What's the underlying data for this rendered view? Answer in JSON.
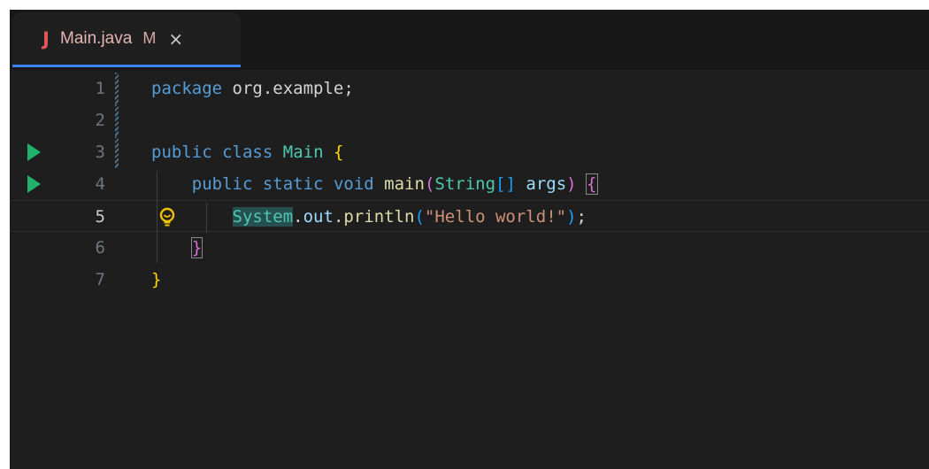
{
  "tab": {
    "icon": "java-icon",
    "name": "Main.java",
    "status": "M",
    "close": "×"
  },
  "lines": [
    {
      "number": "1"
    },
    {
      "number": "2"
    },
    {
      "number": "3"
    },
    {
      "number": "4"
    },
    {
      "number": "5"
    },
    {
      "number": "6"
    },
    {
      "number": "7"
    }
  ],
  "code": {
    "l1": {
      "kw": "package",
      "rest": " org.example;"
    },
    "l3": {
      "kw1": "public",
      "kw2": "class",
      "name": "Main",
      "brace": "{"
    },
    "l4": {
      "kw1": "public",
      "kw2": "static",
      "kw3": "void",
      "fn": "main",
      "lparen": "(",
      "type": "String",
      "arr": "[]",
      "param": "args",
      "rparen": ")",
      "brace": "{"
    },
    "l5": {
      "cls": "System",
      "dot1": ".",
      "field": "out",
      "dot2": ".",
      "fn": "println",
      "lparen": "(",
      "str": "\"Hello world!\"",
      "rparen": ")",
      "semi": ";"
    },
    "l6": {
      "brace": "}"
    },
    "l7": {
      "brace": "}"
    }
  },
  "colors": {
    "background": "#1e1e1e",
    "tab_accent": "#3b82f6",
    "run_icon": "#21b36a",
    "java_icon": "#e35656"
  }
}
